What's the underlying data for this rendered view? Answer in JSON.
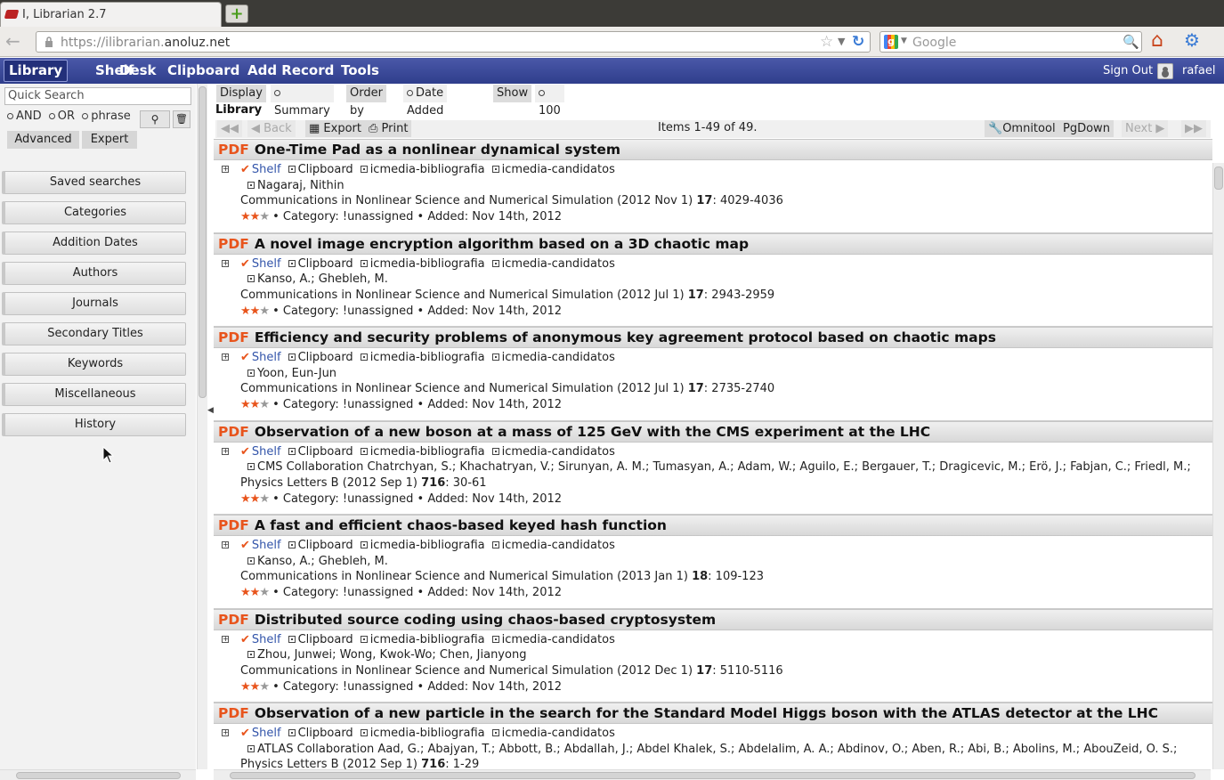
{
  "browser": {
    "tab_title": "I, Librarian 2.7",
    "url_prefix": "https://ilibrarian.",
    "url_domain": "anoluz.net",
    "search_placeholder": "Google"
  },
  "menubar": {
    "items": [
      "Library",
      "Shelf",
      "Desk",
      "Clipboard",
      "Add Record",
      "Tools"
    ],
    "active": "Library",
    "sign_out": "Sign Out",
    "username": "rafael"
  },
  "sidebar": {
    "quick_search_placeholder": "Quick Search",
    "bool_and": "AND",
    "bool_or": "OR",
    "bool_phrase": "phrase",
    "tab_advanced": "Advanced",
    "tab_expert": "Expert",
    "buttons": [
      "Saved searches",
      "Categories",
      "Addition Dates",
      "Authors",
      "Journals",
      "Secondary Titles",
      "Keywords",
      "Miscellaneous",
      "History"
    ]
  },
  "display": {
    "display_label": "Display",
    "display_value": "Summary",
    "order_label": "Order by",
    "order_value": "Date Added",
    "show_label": "Show",
    "show_value": "100",
    "heading": "Library"
  },
  "pager": {
    "back": "Back",
    "export": "Export",
    "print": "Print",
    "items_count": "Items 1-49 of 49.",
    "omnitool": "Omnitool",
    "pgdown": "PgDown",
    "next": "Next"
  },
  "record_common": {
    "pdf": "PDF",
    "shelf": "Shelf",
    "clipboard": "Clipboard",
    "project1": "icmedia-bibliografia",
    "project2": "icmedia-candidatos",
    "category_line": "• Category: !unassigned • Added: Nov 14th, 2012"
  },
  "records": [
    {
      "title": "One-Time Pad as a nonlinear dynamical system",
      "authors": "Nagaraj, Nithin",
      "journal": "Communications in Nonlinear Science and Numerical Simulation (2012 Nov 1)",
      "volume": "17",
      "pages": ": 4029-4036",
      "rating": 2
    },
    {
      "title": "A novel image encryption algorithm based on a 3D chaotic map",
      "authors": "Kanso, A.; Ghebleh, M.",
      "journal": "Communications in Nonlinear Science and Numerical Simulation (2012 Jul 1)",
      "volume": "17",
      "pages": ": 2943-2959",
      "rating": 2
    },
    {
      "title": "Efficiency and security problems of anonymous key agreement protocol based on chaotic maps",
      "authors": "Yoon, Eun-Jun",
      "journal": "Communications in Nonlinear Science and Numerical Simulation (2012 Jul 1)",
      "volume": "17",
      "pages": ": 2735-2740",
      "rating": 2
    },
    {
      "title": "Observation of a new boson at a mass of 125 GeV with the CMS experiment at the LHC",
      "authors": "CMS Collaboration Chatrchyan, S.; Khachatryan, V.; Sirunyan, A. M.; Tumasyan, A.; Adam, W.; Aguilo, E.; Bergauer, T.; Dragicevic, M.; Erö, J.; Fabjan, C.; Friedl, M.;",
      "journal": "Physics Letters B (2012 Sep 1)",
      "volume": "716",
      "pages": ": 30-61",
      "rating": 2
    },
    {
      "title": "A fast and efficient chaos-based keyed hash function",
      "authors": "Kanso, A.; Ghebleh, M.",
      "journal": "Communications in Nonlinear Science and Numerical Simulation (2013 Jan 1)",
      "volume": "18",
      "pages": ": 109-123",
      "rating": 2
    },
    {
      "title": "Distributed source coding using chaos-based cryptosystem",
      "authors": "Zhou, Junwei; Wong, Kwok-Wo; Chen, Jianyong",
      "journal": "Communications in Nonlinear Science and Numerical Simulation (2012 Dec 1)",
      "volume": "17",
      "pages": ": 5110-5116",
      "rating": 2
    },
    {
      "title": "Observation of a new particle in the search for the Standard Model Higgs boson with the ATLAS detector at the LHC",
      "authors": "ATLAS Collaboration Aad, G.; Abajyan, T.; Abbott, B.; Abdallah, J.; Abdel Khalek, S.; Abdelalim, A. A.; Abdinov, O.; Aben, R.; Abi, B.; Abolins, M.; AbouZeid, O. S.;",
      "journal": "Physics Letters B (2012 Sep 1)",
      "volume": "716",
      "pages": ": 1-29",
      "rating": 2
    }
  ]
}
